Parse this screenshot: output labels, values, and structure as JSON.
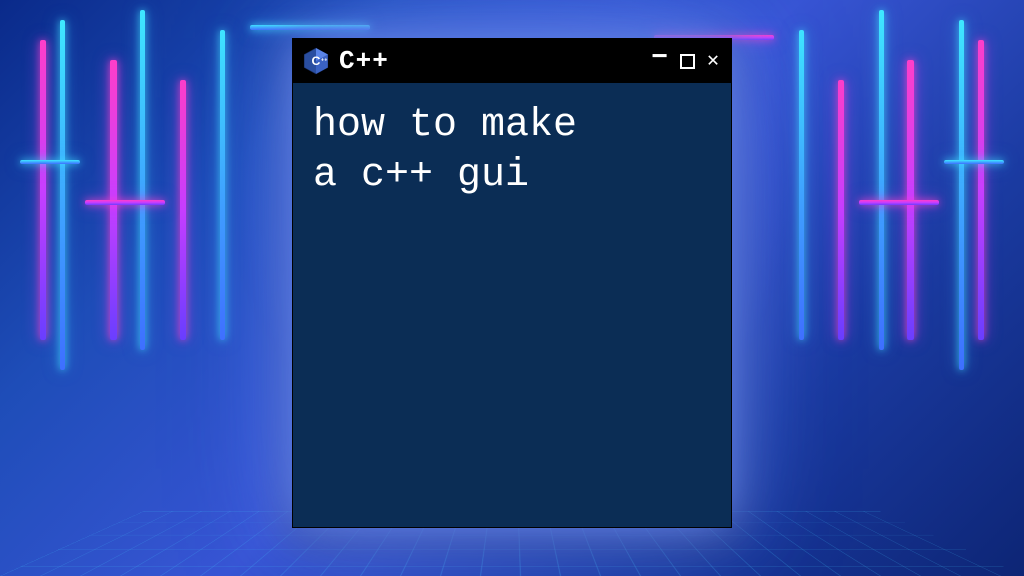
{
  "window": {
    "title": "C++",
    "icon": "cpp-logo-icon"
  },
  "content": {
    "line1": "how to make",
    "line2": "a c++ gui"
  }
}
